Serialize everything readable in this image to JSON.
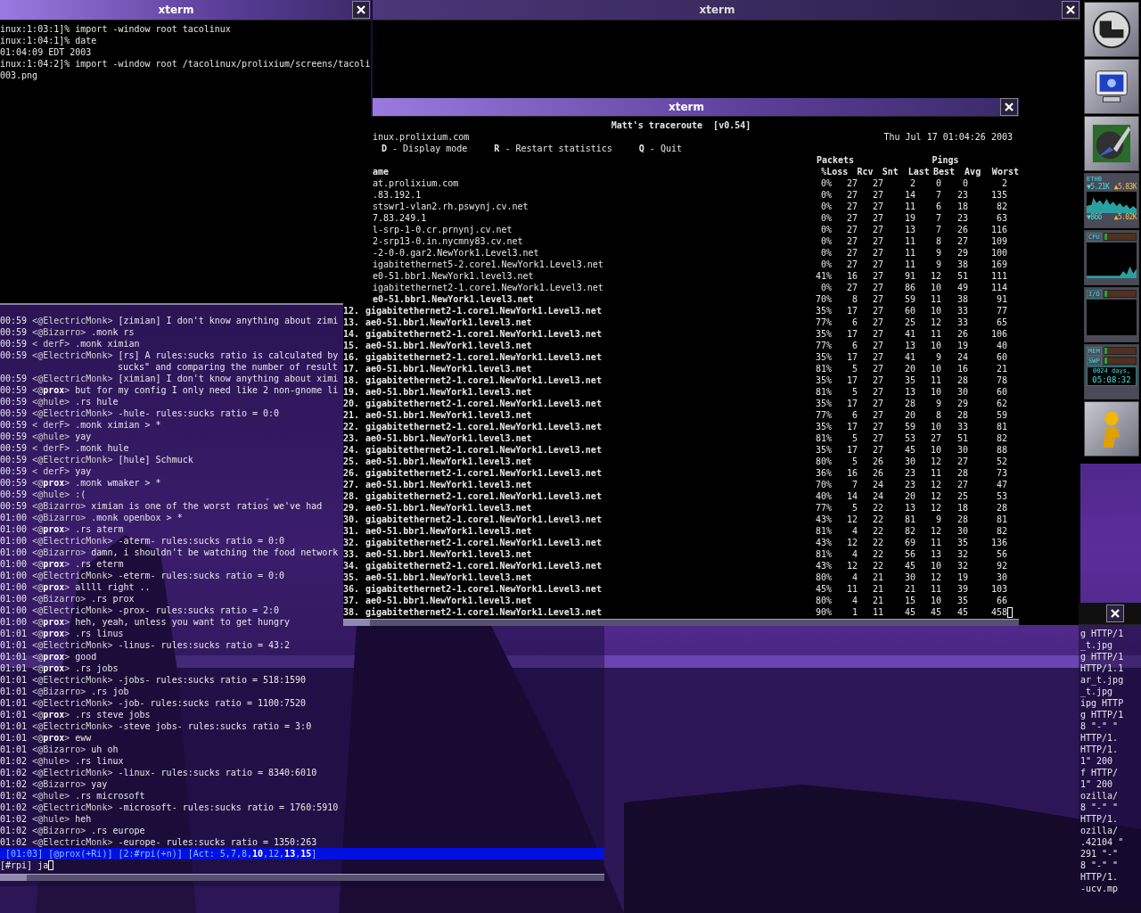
{
  "shell": {
    "title": "xterm",
    "lines": [
      "inux:1:03:1]% import -window root tacolinux",
      "inux:1:04:1]% date",
      "01:04:09 EDT 2003",
      "inux:1:04:2]% import -window root /tacolinux/prolixium/screens/tacoli",
      "003.png"
    ]
  },
  "back": {
    "title": "xterm"
  },
  "mtr": {
    "title": "xterm",
    "heading": "Matt's traceroute  [v0.54]",
    "host": "inux.prolixium.com",
    "date": "Thu Jul 17 01:04:26 2003",
    "keys": [
      "**D** - Display mode",
      "**R** - Restart statistics",
      "**Q** - Quit"
    ],
    "groups": [
      "Packets",
      "Pings"
    ],
    "columns": [
      "ame",
      "%Loss",
      "Rcv",
      "Snt",
      "Last",
      "Best",
      "Avg",
      "Worst"
    ],
    "rows": [
      {
        "host": "at.prolixium.com",
        "bold": false,
        "values": [
          "0%",
          "27",
          "27",
          "2",
          "0",
          "0",
          "2"
        ]
      },
      {
        "host": ".83.192.1",
        "bold": false,
        "values": [
          "0%",
          "27",
          "27",
          "14",
          "7",
          "23",
          "135"
        ]
      },
      {
        "host": "stswr1-vlan2.rh.pswynj.cv.net",
        "bold": false,
        "values": [
          "0%",
          "27",
          "27",
          "11",
          "6",
          "18",
          "82"
        ]
      },
      {
        "host": "7.83.249.1",
        "bold": false,
        "values": [
          "0%",
          "27",
          "27",
          "19",
          "7",
          "23",
          "63"
        ]
      },
      {
        "host": "l-srp-1-0.cr.prnynj.cv.net",
        "bold": false,
        "values": [
          "0%",
          "27",
          "27",
          "13",
          "7",
          "26",
          "116"
        ]
      },
      {
        "host": "2-srp13-0.in.nycmny83.cv.net",
        "bold": false,
        "values": [
          "0%",
          "27",
          "27",
          "11",
          "8",
          "27",
          "109"
        ]
      },
      {
        "host": "-2-0-0.gar2.NewYork1.Level3.net",
        "bold": false,
        "values": [
          "0%",
          "27",
          "27",
          "11",
          "9",
          "29",
          "100"
        ]
      },
      {
        "host": "igabitethernet5-2.core1.NewYork1.Level3.net",
        "bold": false,
        "values": [
          "0%",
          "27",
          "27",
          "11",
          "9",
          "38",
          "169"
        ]
      },
      {
        "host": "e0-51.bbr1.NewYork1.level3.net",
        "bold": false,
        "values": [
          "41%",
          "16",
          "27",
          "91",
          "12",
          "51",
          "111"
        ]
      },
      {
        "host": "igabitethernet2-1.core1.NewYork1.Level3.net",
        "bold": false,
        "values": [
          "0%",
          "27",
          "27",
          "86",
          "10",
          "49",
          "114"
        ]
      },
      {
        "host": "e0-51.bbr1.NewYork1.level3.net",
        "bold": true,
        "values": [
          "70%",
          "8",
          "27",
          "59",
          "11",
          "38",
          "91"
        ]
      },
      {
        "num": "12.",
        "host": "gigabitethernet2-1.core1.NewYork1.Level3.net",
        "bold": true,
        "values": [
          "35%",
          "17",
          "27",
          "60",
          "10",
          "33",
          "77"
        ]
      },
      {
        "num": "13.",
        "host": "ae0-51.bbr1.NewYork1.level3.net",
        "bold": true,
        "values": [
          "77%",
          "6",
          "27",
          "25",
          "12",
          "33",
          "65"
        ]
      },
      {
        "num": "14.",
        "host": "gigabitethernet2-1.core1.NewYork1.Level3.net",
        "bold": true,
        "values": [
          "35%",
          "17",
          "27",
          "41",
          "11",
          "26",
          "106"
        ]
      },
      {
        "num": "15.",
        "host": "ae0-51.bbr1.NewYork1.level3.net",
        "bold": true,
        "values": [
          "77%",
          "6",
          "27",
          "13",
          "10",
          "19",
          "40"
        ]
      },
      {
        "num": "16.",
        "host": "gigabitethernet2-1.core1.NewYork1.Level3.net",
        "bold": true,
        "values": [
          "35%",
          "17",
          "27",
          "41",
          "9",
          "24",
          "60"
        ]
      },
      {
        "num": "17.",
        "host": "ae0-51.bbr1.NewYork1.level3.net",
        "bold": true,
        "values": [
          "81%",
          "5",
          "27",
          "20",
          "10",
          "16",
          "21"
        ]
      },
      {
        "num": "18.",
        "host": "gigabitethernet2-1.core1.NewYork1.Level3.net",
        "bold": true,
        "values": [
          "35%",
          "17",
          "27",
          "35",
          "11",
          "28",
          "78"
        ]
      },
      {
        "num": "19.",
        "host": "ae0-51.bbr1.NewYork1.level3.net",
        "bold": true,
        "values": [
          "81%",
          "5",
          "27",
          "13",
          "10",
          "30",
          "60"
        ]
      },
      {
        "num": "20.",
        "host": "gigabitethernet2-1.core1.NewYork1.Level3.net",
        "bold": true,
        "values": [
          "35%",
          "17",
          "27",
          "28",
          "9",
          "29",
          "62"
        ]
      },
      {
        "num": "21.",
        "host": "ae0-51.bbr1.NewYork1.level3.net",
        "bold": true,
        "values": [
          "77%",
          "6",
          "27",
          "20",
          "8",
          "28",
          "59"
        ]
      },
      {
        "num": "22.",
        "host": "gigabitethernet2-1.core1.NewYork1.Level3.net",
        "bold": true,
        "values": [
          "35%",
          "17",
          "27",
          "59",
          "10",
          "33",
          "81"
        ]
      },
      {
        "num": "23.",
        "host": "ae0-51.bbr1.NewYork1.level3.net",
        "bold": true,
        "values": [
          "81%",
          "5",
          "27",
          "53",
          "27",
          "51",
          "82"
        ]
      },
      {
        "num": "24.",
        "host": "gigabitethernet2-1.core1.NewYork1.Level3.net",
        "bold": true,
        "values": [
          "35%",
          "17",
          "27",
          "45",
          "10",
          "30",
          "88"
        ]
      },
      {
        "num": "25.",
        "host": "ae0-51.bbr1.NewYork1.level3.net",
        "bold": true,
        "values": [
          "80%",
          "5",
          "26",
          "30",
          "12",
          "27",
          "52"
        ]
      },
      {
        "num": "26.",
        "host": "gigabitethernet2-1.core1.NewYork1.Level3.net",
        "bold": true,
        "values": [
          "36%",
          "16",
          "26",
          "23",
          "11",
          "28",
          "73"
        ]
      },
      {
        "num": "27.",
        "host": "ae0-51.bbr1.NewYork1.level3.net",
        "bold": true,
        "values": [
          "70%",
          "7",
          "24",
          "23",
          "12",
          "27",
          "47"
        ]
      },
      {
        "num": "28.",
        "host": "gigabitethernet2-1.core1.NewYork1.Level3.net",
        "bold": true,
        "values": [
          "40%",
          "14",
          "24",
          "20",
          "12",
          "25",
          "53"
        ]
      },
      {
        "num": "29.",
        "host": "ae0-51.bbr1.NewYork1.level3.net",
        "bold": true,
        "values": [
          "77%",
          "5",
          "22",
          "13",
          "12",
          "18",
          "28"
        ]
      },
      {
        "num": "30.",
        "host": "gigabitethernet2-1.core1.NewYork1.Level3.net",
        "bold": true,
        "values": [
          "43%",
          "12",
          "22",
          "81",
          "9",
          "28",
          "81"
        ]
      },
      {
        "num": "31.",
        "host": "ae0-51.bbr1.NewYork1.level3.net",
        "bold": true,
        "values": [
          "81%",
          "4",
          "22",
          "82",
          "12",
          "30",
          "82"
        ]
      },
      {
        "num": "32.",
        "host": "gigabitethernet2-1.core1.NewYork1.Level3.net",
        "bold": true,
        "values": [
          "43%",
          "12",
          "22",
          "69",
          "11",
          "35",
          "136"
        ]
      },
      {
        "num": "33.",
        "host": "ae0-51.bbr1.NewYork1.level3.net",
        "bold": true,
        "values": [
          "81%",
          "4",
          "22",
          "56",
          "13",
          "32",
          "56"
        ]
      },
      {
        "num": "34.",
        "host": "gigabitethernet2-1.core1.NewYork1.Level3.net",
        "bold": true,
        "values": [
          "43%",
          "12",
          "22",
          "45",
          "10",
          "32",
          "92"
        ]
      },
      {
        "num": "35.",
        "host": "ae0-51.bbr1.NewYork1.level3.net",
        "bold": true,
        "values": [
          "80%",
          "4",
          "21",
          "30",
          "12",
          "19",
          "30"
        ]
      },
      {
        "num": "36.",
        "host": "gigabitethernet2-1.core1.NewYork1.Level3.net",
        "bold": true,
        "values": [
          "45%",
          "11",
          "21",
          "21",
          "11",
          "39",
          "103"
        ]
      },
      {
        "num": "37.",
        "host": "ae0-51.bbr1.NewYork1.level3.net",
        "bold": true,
        "values": [
          "80%",
          "4",
          "21",
          "15",
          "10",
          "35",
          "66"
        ]
      },
      {
        "num": "38.",
        "host": "gigabitethernet2-1.core1.NewYork1.Level3.net",
        "bold": true,
        "values": [
          "90%",
          "1",
          "11",
          "45",
          "45",
          "45",
          "458"
        ]
      }
    ]
  },
  "irc": {
    "lines": [
      {
        "kind": "message",
        "time": "00:59",
        "nick": "<@ElectricMonk>",
        "text": "[zimian] I don't know anything about zimi"
      },
      {
        "kind": "message",
        "time": "00:59",
        "nick": "<@Bizarro>",
        "text": ".monk rs"
      },
      {
        "kind": "message",
        "time": "00:59",
        "nick": "< derF>",
        "text": ".monk ximian"
      },
      {
        "kind": "message",
        "time": "00:59",
        "nick": "<@ElectricMonk>",
        "text": "[rs] A rules:sucks ratio is calculated by"
      },
      {
        "kind": "continuation",
        "text": "sucks\" and comparing the number of result"
      },
      {
        "kind": "message",
        "time": "00:59",
        "nick": "<@ElectricMonk>",
        "text": "[ximian] I don't know anything about ximi"
      },
      {
        "kind": "message",
        "time": "00:59",
        "nick": "<@**prox**>",
        "text": "but for my config I only need like 2 non-gnome li"
      },
      {
        "kind": "message",
        "time": "00:59",
        "nick": "<@hule>",
        "text": ".rs hule"
      },
      {
        "kind": "message",
        "time": "00:59",
        "nick": "<@ElectricMonk>",
        "text": "-hule- rules:sucks ratio = 0:0"
      },
      {
        "kind": "message",
        "time": "00:59",
        "nick": "< derF>",
        "text": ".monk ximian > *"
      },
      {
        "kind": "message",
        "time": "00:59",
        "nick": "<@hule>",
        "text": "yay"
      },
      {
        "kind": "message",
        "time": "00:59",
        "nick": "< derF>",
        "text": ".monk hule"
      },
      {
        "kind": "message",
        "time": "00:59",
        "nick": "<@ElectricMonk>",
        "text": "[hule] Schmuck"
      },
      {
        "kind": "message",
        "time": "00:59",
        "nick": "< derF>",
        "text": "yay"
      },
      {
        "kind": "message",
        "time": "00:59",
        "nick": "<@**prox**>",
        "text": ".monk wmaker > *"
      },
      {
        "kind": "message",
        "time": "00:59",
        "nick": "<@hule>",
        "text": ":("
      },
      {
        "kind": "message",
        "time": "00:59",
        "nick": "<@Bizarro>",
        "text": "ximian is one of the worst ratios we've had"
      },
      {
        "kind": "message",
        "time": "01:00",
        "nick": "<@Bizarro>",
        "text": ".monk openbox > *"
      },
      {
        "kind": "message",
        "time": "01:00",
        "nick": "<@**prox**>",
        "text": ".rs aterm"
      },
      {
        "kind": "message",
        "time": "01:00",
        "nick": "<@ElectricMonk>",
        "text": "-aterm- rules:sucks ratio = 0:0"
      },
      {
        "kind": "message",
        "time": "01:00",
        "nick": "<@Bizarro>",
        "text": "damn, i shouldn't be watching the food network"
      },
      {
        "kind": "message",
        "time": "01:00",
        "nick": "<@**prox**>",
        "text": ".rs eterm"
      },
      {
        "kind": "message",
        "time": "01:00",
        "nick": "<@ElectricMonk>",
        "text": "-eterm- rules:sucks ratio = 0:0"
      },
      {
        "kind": "message",
        "time": "01:00",
        "nick": "<@**prox**>",
        "text": "allll right .."
      },
      {
        "kind": "message",
        "time": "01:00",
        "nick": "<@Bizarro>",
        "text": ".rs prox"
      },
      {
        "kind": "message",
        "time": "01:00",
        "nick": "<@ElectricMonk>",
        "text": "-prox- rules:sucks ratio = 2:0"
      },
      {
        "kind": "message",
        "time": "01:00",
        "nick": "<@**prox**>",
        "text": "heh, yeah, unless you want to get hungry"
      },
      {
        "kind": "message",
        "time": "01:01",
        "nick": "<@**prox**>",
        "text": ".rs linus"
      },
      {
        "kind": "message",
        "time": "01:01",
        "nick": "<@ElectricMonk>",
        "text": "-linus- rules:sucks ratio = 43:2"
      },
      {
        "kind": "message",
        "time": "01:01",
        "nick": "<@**prox**>",
        "text": "good"
      },
      {
        "kind": "message",
        "time": "01:01",
        "nick": "<@**prox**>",
        "text": ".rs jobs"
      },
      {
        "kind": "message",
        "time": "01:01",
        "nick": "<@ElectricMonk>",
        "text": "-jobs- rules:sucks ratio = 518:1590"
      },
      {
        "kind": "message",
        "time": "01:01",
        "nick": "<@Bizarro>",
        "text": ".rs job"
      },
      {
        "kind": "message",
        "time": "01:01",
        "nick": "<@ElectricMonk>",
        "text": "-job- rules:sucks ratio = 1100:7520"
      },
      {
        "kind": "message",
        "time": "01:01",
        "nick": "<@**prox**>",
        "text": ".rs steve jobs"
      },
      {
        "kind": "message",
        "time": "01:01",
        "nick": "<@ElectricMonk>",
        "text": "-steve jobs- rules:sucks ratio = 3:0"
      },
      {
        "kind": "message",
        "time": "01:01",
        "nick": "<@**prox**>",
        "text": "eww"
      },
      {
        "kind": "message",
        "time": "01:01",
        "nick": "<@Bizarro>",
        "text": "uh oh"
      },
      {
        "kind": "message",
        "time": "01:02",
        "nick": "<@hule>",
        "text": ".rs linux"
      },
      {
        "kind": "message",
        "time": "01:02",
        "nick": "<@ElectricMonk>",
        "text": "-linux- rules:sucks ratio = 8340:6010"
      },
      {
        "kind": "message",
        "time": "01:02",
        "nick": "<@Bizarro>",
        "text": "yay"
      },
      {
        "kind": "message",
        "time": "01:02",
        "nick": "<@hule>",
        "text": ".rs microsoft"
      },
      {
        "kind": "message",
        "time": "01:02",
        "nick": "<@ElectricMonk>",
        "text": "-microsoft- rules:sucks ratio = 1760:5910"
      },
      {
        "kind": "message",
        "time": "01:02",
        "nick": "<@hule>",
        "text": "heh"
      },
      {
        "kind": "message",
        "time": "01:02",
        "nick": "<@Bizarro>",
        "text": ".rs europe"
      },
      {
        "kind": "message",
        "time": "01:02",
        "nick": "<@ElectricMonk>",
        "text": "-europe- rules:sucks ratio = 1350:263"
      }
    ],
    "status": " [01:03] [@prox(+Ri)] [2:#rpi(+n)] [Act: 5,7,8,**10**,12,**13**,**15**]",
    "input": "[#rpi] ja"
  },
  "log": {
    "lines": [
      "g HTTP/1",
      "_t.jpg",
      "g HTTP/1",
      "HTTP/1.1",
      "ar_t.jpg",
      "_t.jpg",
      "ipg HTTP",
      "g HTTP/1",
      "8 \"-\" \"",
      "HTTP/1.",
      "HTTP/1.",
      "1\" 200",
      "f HTTP/",
      "1\" 200",
      "ozilla/",
      "8 \"-\" \"",
      "HTTP/1.",
      "ozilla/",
      ".42104 \"",
      "291 \"-\"",
      "8 \"-\" \"",
      "HTTP/1.",
      "-ucv.mp"
    ]
  },
  "dock": {
    "net": {
      "label": "ETH0",
      "rx": "▼5.21K",
      "tx": "▲5.83K",
      "rx_total": "▼866",
      "tx_total": "▲5.02K"
    },
    "cpu": "CPU",
    "io": "I/O",
    "mem": "MEM",
    "swap": "SWP",
    "uptime_days": "0024 days,",
    "uptime_time": "05:08:32"
  }
}
